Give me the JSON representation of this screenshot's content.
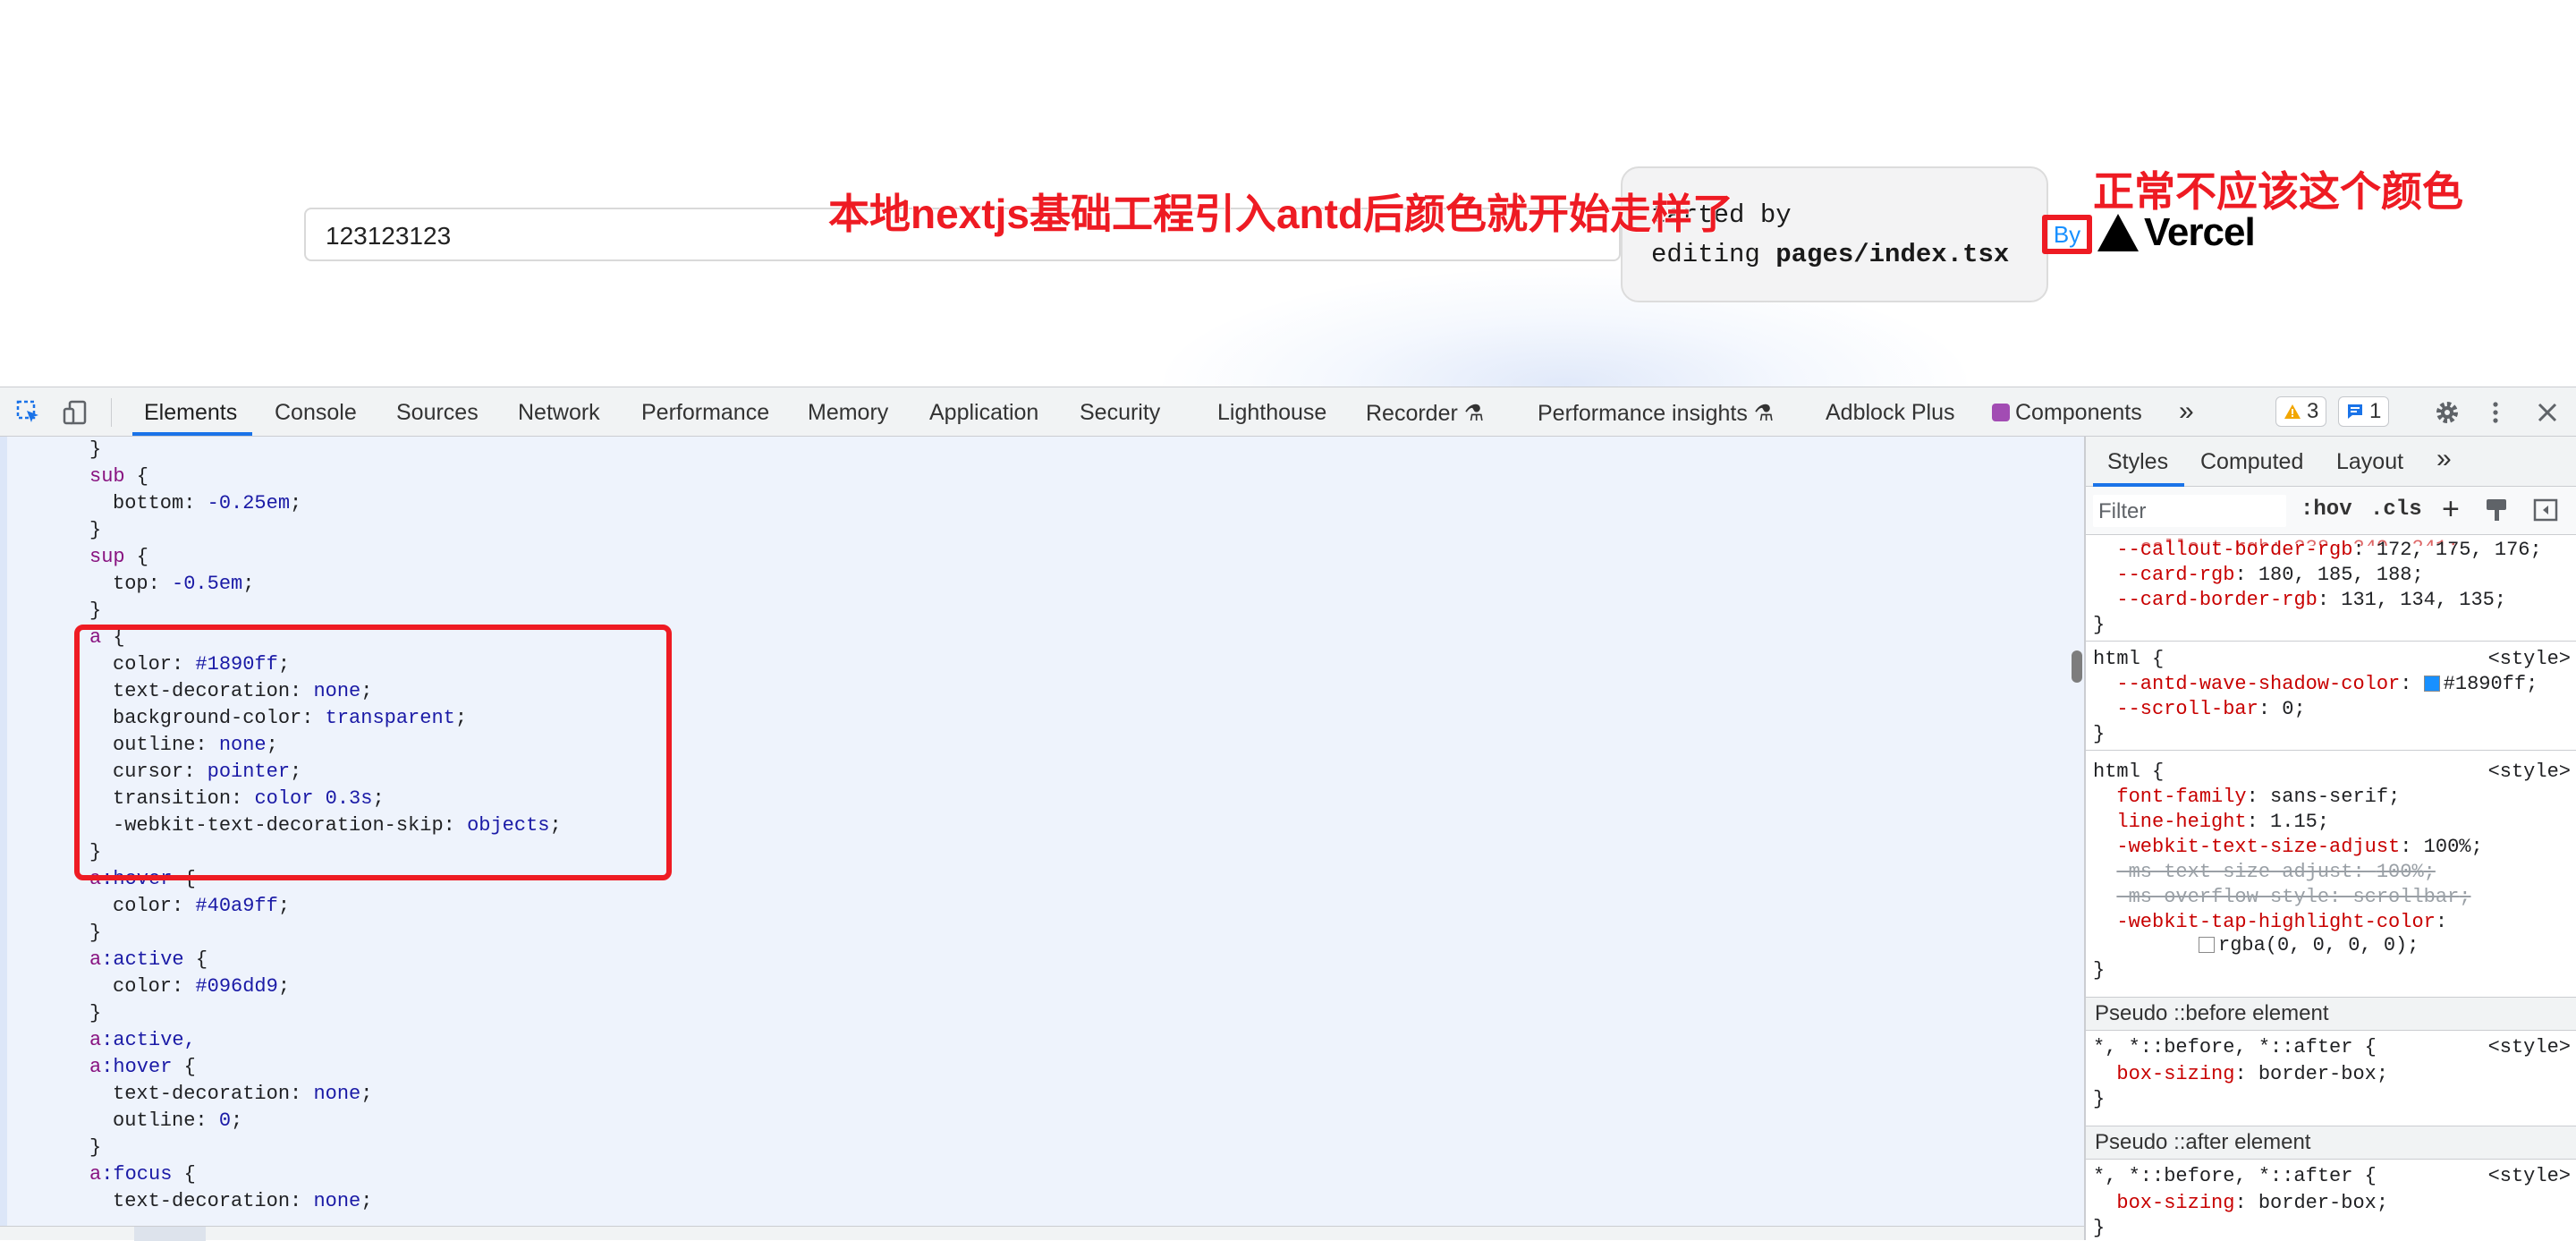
{
  "page": {
    "input_value": "123123123",
    "card_line1": "tarted by",
    "card_line2_prefix": "editing ",
    "card_line2_file": "pages/index.tsx",
    "by_label": "By",
    "vercel_label": "Vercel",
    "annotation_main": "本地nextjs基础工程引入antd后颜色就开始走样了",
    "annotation_side": "正常不应该这个颜色"
  },
  "devtools": {
    "tabs": [
      "Elements",
      "Console",
      "Sources",
      "Network",
      "Performance",
      "Memory",
      "Application",
      "Security",
      "Lighthouse",
      "Recorder",
      "Performance insights",
      "Adblock Plus",
      "Components"
    ],
    "warnings_count": "3",
    "messages_count": "1"
  },
  "code": {
    "l0": "}",
    "l1_sel": "sub",
    "l2_prop": "bottom",
    "l2_val": "-0.25em",
    "l4_sel": "sup",
    "l5_prop": "top",
    "l5_val": "-0.5em",
    "a_sel": "a",
    "a1_prop": "color",
    "a1_val": "#1890ff",
    "a2_prop": "text-decoration",
    "a2_val": "none",
    "a3_prop": "background-color",
    "a3_val": "transparent",
    "a4_prop": "outline",
    "a4_val": "none",
    "a5_prop": "cursor",
    "a5_val": "pointer",
    "a6_prop": "transition",
    "a6_val_a": "color",
    "a6_val_b": "0.3s",
    "a7_prop": "-webkit-text-decoration-skip",
    "a7_val": "objects",
    "hover_sel_a": "a",
    "hover_sel_b": ":hover",
    "hover_prop": "color",
    "hover_val": "#40a9ff",
    "active_sel_a": "a",
    "active_sel_b": ":active",
    "active_prop": "color",
    "active_val": "#096dd9",
    "ah_sel1_a": "a",
    "ah_sel1_b": ":active,",
    "ah_sel2_a": "a",
    "ah_sel2_b": ":hover",
    "ah_p1": "text-decoration",
    "ah_v1": "none",
    "ah_p2": "outline",
    "ah_v2": "0",
    "focus_sel_a": "a",
    "focus_sel_b": ":focus",
    "focus_prop": "text-decoration",
    "focus_val": "none"
  },
  "styles": {
    "tabs": [
      "Styles",
      "Computed",
      "Layout"
    ],
    "filter_placeholder": "Filter",
    "hov": ":hov",
    "cls": ".cls",
    "r0_p1": "--callout-border-rgb",
    "r0_v1": "172, 175, 176",
    "r0_p2": "--card-rgb",
    "r0_v2": "180, 185, 188",
    "r0_p3": "--card-border-rgb",
    "r0_v3": "131, 134, 135",
    "html_sel": "html",
    "src_style": "<style>",
    "r1_p1": "--antd-wave-shadow-color",
    "r1_v1": "#1890ff",
    "r1_p2": "--scroll-bar",
    "r1_v2": "0",
    "r2_p1": "font-family",
    "r2_v1": "sans-serif",
    "r2_p2": "line-height",
    "r2_v2": "1.15",
    "r2_p3": "-webkit-text-size-adjust",
    "r2_v3": "100%",
    "r2_p4": "-ms-text-size-adjust",
    "r2_v4": "100%",
    "r2_p5": "-ms-overflow-style",
    "r2_v5": "scrollbar",
    "r2_p6": "-webkit-tap-highlight-color",
    "r2_v6": "rgba(0, 0, 0, 0)",
    "pseudo_before": "Pseudo ::before element",
    "pseudo_after": "Pseudo ::after element",
    "univ_sel": "*, *::before, *::after {",
    "bs_prop": "box-sizing",
    "bs_val": "border-box"
  }
}
